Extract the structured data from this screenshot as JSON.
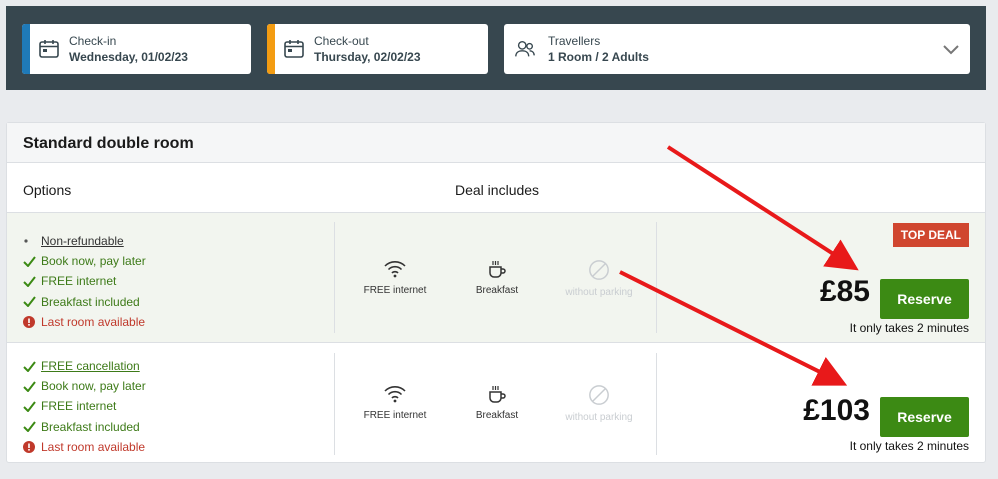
{
  "search": {
    "checkin": {
      "label": "Check-in",
      "value": "Wednesday, 01/02/23",
      "accent": "#1f7ab8"
    },
    "checkout": {
      "label": "Check-out",
      "value": "Thursday, 02/02/23",
      "accent": "#f39c12"
    },
    "travellers": {
      "label": "Travellers",
      "value": "1 Room / 2 Adults"
    }
  },
  "room": {
    "title": "Standard double room",
    "col_options": "Options",
    "col_deal": "Deal includes",
    "offers": [
      {
        "options": [
          {
            "text": "Non-refundable",
            "icon": "bullet"
          },
          {
            "text": "Book now, pay later",
            "icon": "check-icon"
          },
          {
            "text": "FREE internet",
            "icon": "check-icon"
          },
          {
            "text": "Breakfast included",
            "icon": "check-icon"
          },
          {
            "text": "Last room available",
            "icon": "alert-icon"
          }
        ],
        "amenities": [
          {
            "label": "FREE internet",
            "icon": "wifi-icon"
          },
          {
            "label": "Breakfast",
            "icon": "coffee-cup-icon"
          },
          {
            "label": "without parking",
            "icon": "no-parking-icon"
          }
        ],
        "badge": "TOP DEAL",
        "price": "£85",
        "reserve_label": "Reserve",
        "note": "It only takes 2 minutes"
      },
      {
        "options": [
          {
            "text": "FREE cancellation",
            "icon": "check-icon"
          },
          {
            "text": "Book now, pay later",
            "icon": "check-icon"
          },
          {
            "text": "FREE internet",
            "icon": "check-icon"
          },
          {
            "text": "Breakfast included",
            "icon": "check-icon"
          },
          {
            "text": "Last room available",
            "icon": "alert-icon"
          }
        ],
        "amenities": [
          {
            "label": "FREE internet",
            "icon": "wifi-icon"
          },
          {
            "label": "Breakfast",
            "icon": "coffee-cup-icon"
          },
          {
            "label": "without parking",
            "icon": "no-parking-icon"
          }
        ],
        "price": "£103",
        "reserve_label": "Reserve",
        "note": "It only takes 2 minutes"
      }
    ]
  },
  "colors": {
    "success": "#3c8a14",
    "warning": "#c0392b",
    "badge": "#d0462f",
    "header_bg": "#37474f",
    "annotation_arrow": "#e8191a"
  }
}
